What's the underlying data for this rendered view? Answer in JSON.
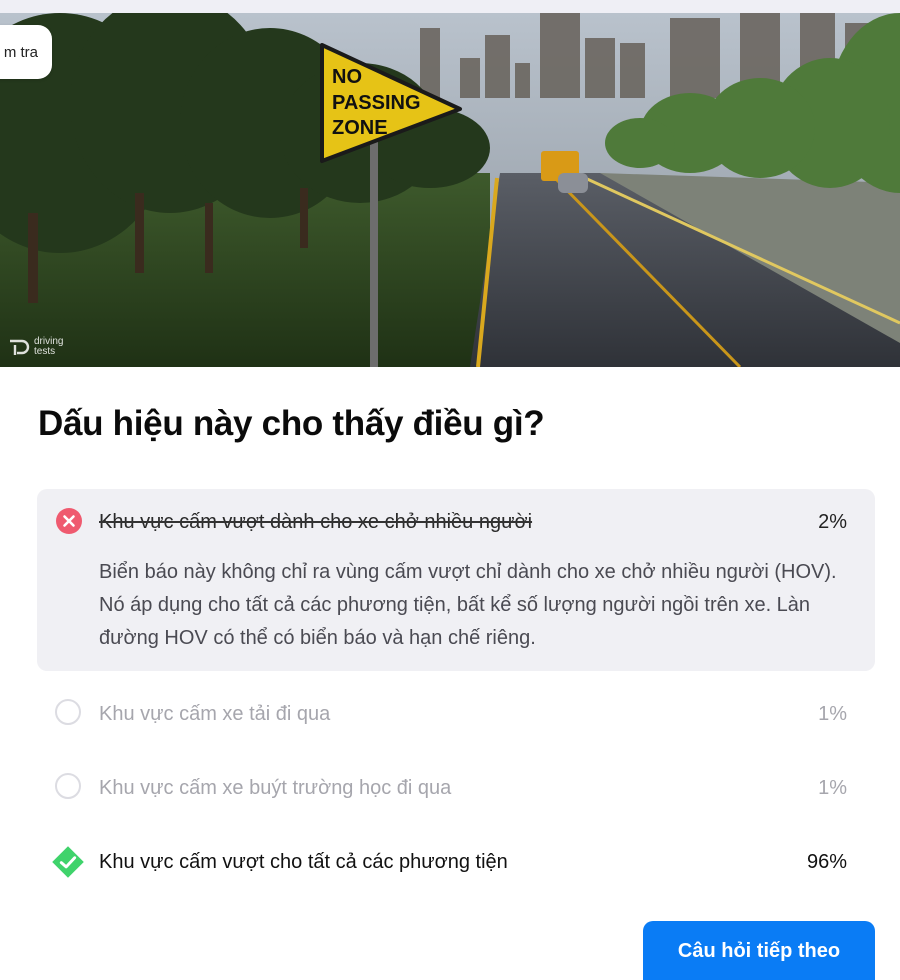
{
  "header": {
    "pill_text": "m tra"
  },
  "hero": {
    "sign_text": [
      "NO",
      "PASSING",
      "ZONE"
    ],
    "watermark": "driving\ntests"
  },
  "question": {
    "text": "Dấu hiệu này cho thấy điều gì?"
  },
  "options": [
    {
      "label": "Khu vực cấm vượt dành cho xe chở nhiều người",
      "percent": "2%",
      "state": "wrong-selected",
      "icon": "x-circle-icon"
    },
    {
      "label": "Khu vực cấm xe tải đi qua",
      "percent": "1%",
      "state": "unselected",
      "icon": "radio-circle-icon"
    },
    {
      "label": "Khu vực cấm xe buýt trường học đi qua",
      "percent": "1%",
      "state": "unselected",
      "icon": "radio-circle-icon"
    },
    {
      "label": "Khu vực cấm vượt cho tất cả các phương tiện",
      "percent": "96%",
      "state": "correct",
      "icon": "check-diamond-icon"
    }
  ],
  "explanation": "Biển báo này không chỉ ra vùng cấm vượt chỉ dành cho xe chở nhiều người (HOV). Nó áp dụng cho tất cả các phương tiện, bất kể số lượng người ngồi trên xe. Làn đường HOV có thể có biển báo và hạn chế riêng.",
  "actions": {
    "next_label": "Câu hỏi tiếp theo"
  },
  "colors": {
    "accent": "#0a7cf5",
    "wrong": "#ef5a6f",
    "correct": "#3fd36b",
    "card_bg": "#f0f0f4"
  }
}
